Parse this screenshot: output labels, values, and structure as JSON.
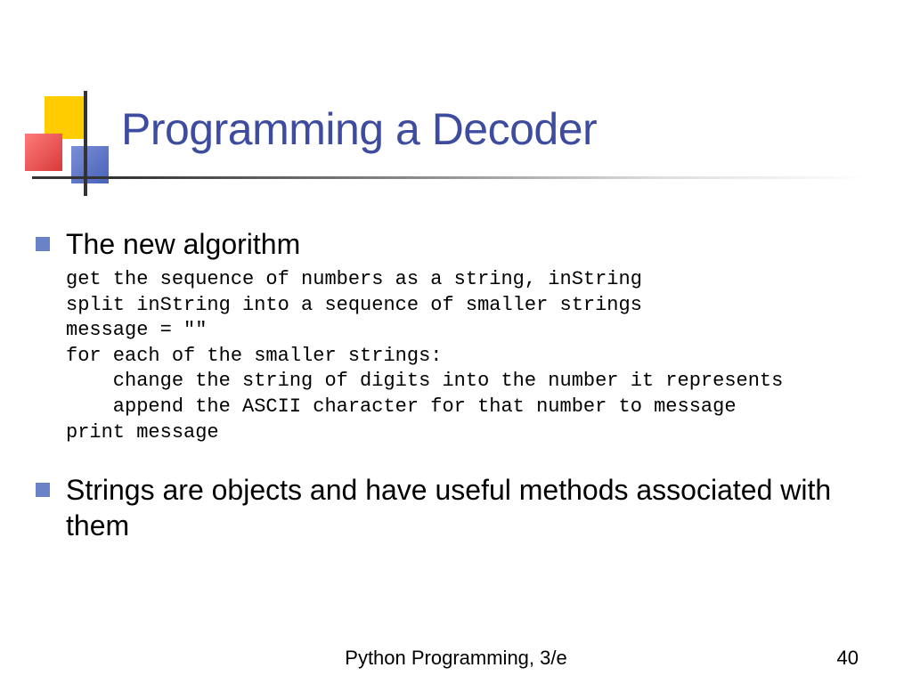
{
  "title": "Programming a Decoder",
  "bullets": {
    "item1": "The new algorithm",
    "item2": "Strings are objects and have useful methods associated with them"
  },
  "code": "get the sequence of numbers as a string, inString\nsplit inString into a sequence of smaller strings\nmessage = \"\"\nfor each of the smaller strings:\n    change the string of digits into the number it represents\n    append the ASCII character for that number to message\nprint message",
  "footer": {
    "center": "Python Programming, 3/e",
    "page": "40"
  }
}
